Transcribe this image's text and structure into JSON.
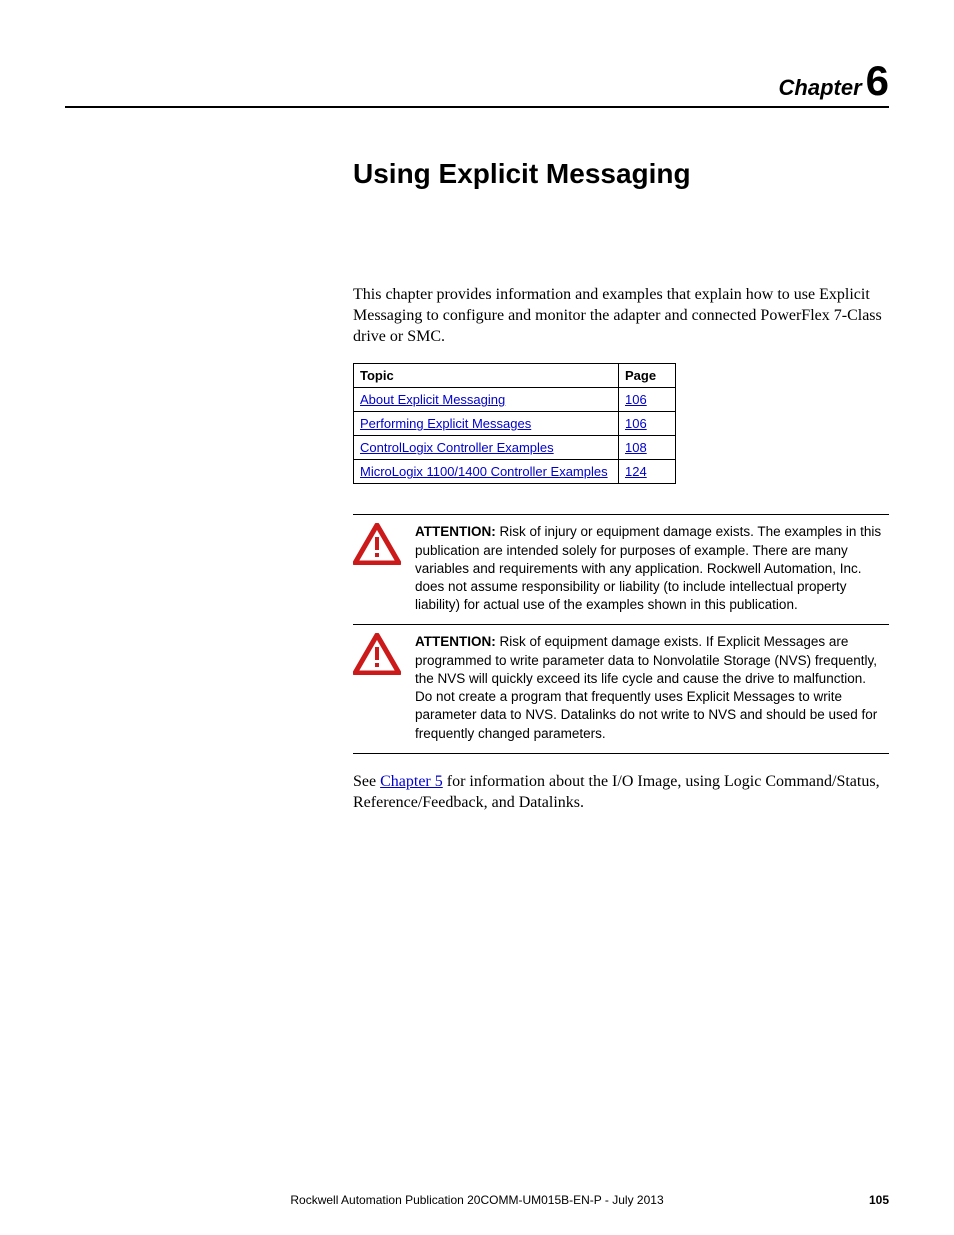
{
  "chapter": {
    "word": "Chapter",
    "number": "6"
  },
  "title": "Using Explicit Messaging",
  "intro": "This chapter provides information and examples that explain how to use Explicit Messaging to configure and monitor the adapter and connected PowerFlex 7-Class drive or SMC.",
  "table": {
    "headers": {
      "topic": "Topic",
      "page": "Page"
    },
    "rows": [
      {
        "topic": "About Explicit Messaging",
        "page": "106"
      },
      {
        "topic": "Performing Explicit Messages",
        "page": "106"
      },
      {
        "topic": "ControlLogix Controller Examples",
        "page": "108"
      },
      {
        "topic": "MicroLogix 1100/1400 Controller Examples",
        "page": "124"
      }
    ]
  },
  "attention": [
    {
      "label": "ATTENTION:",
      "text": " Risk of injury or equipment damage exists. The examples in this publication are intended solely for purposes of example. There are many variables and requirements with any application. Rockwell Automation, Inc. does not assume responsibility or liability (to include intellectual property liability) for actual use of the examples shown in this publication."
    },
    {
      "label": "ATTENTION:",
      "text": " Risk of equipment damage exists. If Explicit Messages are programmed to write parameter data to Nonvolatile Storage (NVS) frequently, the NVS will quickly exceed its life cycle and cause the drive to malfunction. Do not create a program that frequently uses Explicit Messages to write parameter data to NVS. Datalinks do not write to NVS and should be used for frequently changed parameters."
    }
  ],
  "see": {
    "pre": "See ",
    "link": "Chapter 5",
    "post": " for information about the I/O Image, using Logic Command/Status, Reference/Feedback, and Datalinks."
  },
  "footer": {
    "pub": "Rockwell Automation Publication 20COMM-UM015B-EN-P - July 2013",
    "page": "105"
  }
}
